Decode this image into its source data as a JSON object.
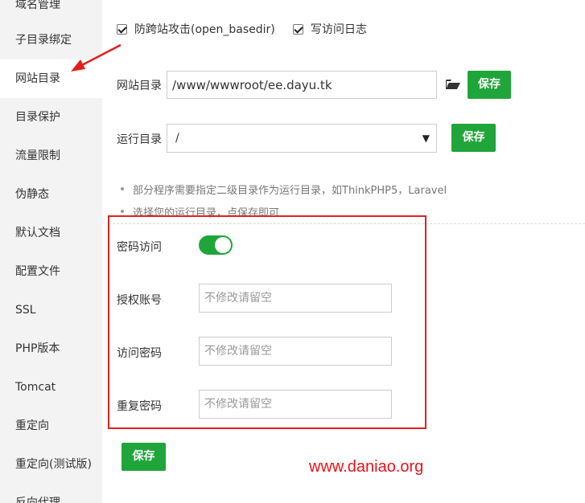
{
  "sidebar": {
    "items": [
      {
        "label": "域名管理"
      },
      {
        "label": "子目录绑定"
      },
      {
        "label": "网站目录"
      },
      {
        "label": "目录保护"
      },
      {
        "label": "流量限制"
      },
      {
        "label": "伪静态"
      },
      {
        "label": "默认文档"
      },
      {
        "label": "配置文件"
      },
      {
        "label": "SSL"
      },
      {
        "label": "PHP版本"
      },
      {
        "label": "Tomcat"
      },
      {
        "label": "重定向"
      },
      {
        "label": "重定向(测试版)"
      },
      {
        "label": "反向代理"
      }
    ],
    "active_label": "网站目录"
  },
  "options": {
    "anti_xss_label": "防跨站攻击(open_basedir)",
    "anti_xss_checked": true,
    "access_log_label": "写访问日志",
    "access_log_checked": true
  },
  "site_dir": {
    "label": "网站目录",
    "value": "/www/wwwroot/ee.dayu.tk",
    "save_label": "保存",
    "folder_icon": "folder-open-icon"
  },
  "run_dir": {
    "label": "运行目录",
    "value": "/",
    "save_label": "保存",
    "arrow": "▼"
  },
  "tips": [
    "部分程序需要指定二级目录作为运行目录，如ThinkPHP5，Laravel",
    "选择您的运行目录，点保存即可"
  ],
  "password_access": {
    "label": "密码访问",
    "enabled": true,
    "account_label": "授权账号",
    "account_placeholder": "不修改请留空",
    "password_label": "访问密码",
    "password_placeholder": "不修改请留空",
    "repeat_label": "重复密码",
    "repeat_placeholder": "不修改请留空",
    "save_label": "保存"
  },
  "watermark": "www.daniao.org",
  "colors": {
    "accent": "#20a53a",
    "annotation": "#e02020"
  }
}
